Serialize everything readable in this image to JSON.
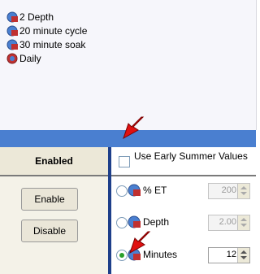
{
  "programs": {
    "items": [
      {
        "label": "2 Depth",
        "icon": "globe-plot-icon"
      },
      {
        "label": "20 minute cycle",
        "icon": "globe-plot-icon"
      },
      {
        "label": "30 minute soak",
        "icon": "globe-plot-icon"
      },
      {
        "label": "Daily",
        "icon": "globe-icon"
      }
    ]
  },
  "status": {
    "header": "Enabled",
    "enable_label": "Enable",
    "disable_label": "Disable"
  },
  "options": {
    "early_summer_label": "Use Early Summer Values",
    "early_summer_checked": false,
    "rows": [
      {
        "label": "% ET",
        "value": "200",
        "selected": false,
        "enabled": false
      },
      {
        "label": "Depth",
        "value": "2.00",
        "selected": false,
        "enabled": false
      },
      {
        "label": "Minutes",
        "value": "12",
        "selected": true,
        "enabled": true
      }
    ]
  },
  "colors": {
    "bar_blue": "#4a7fd0",
    "divider_blue": "#1e3f8a",
    "arrow_red": "#e01010",
    "selected_radio": "#2aa02a"
  }
}
